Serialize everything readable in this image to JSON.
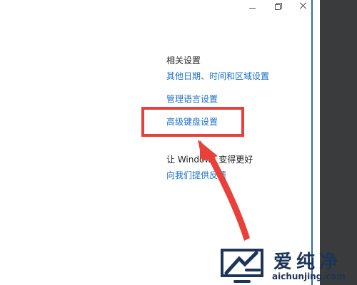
{
  "window_controls": {
    "minimize_icon": "minimize-icon",
    "restore_icon": "restore-icon",
    "close_icon": "close-icon"
  },
  "related_settings": {
    "title": "相关设置",
    "links": [
      "其他日期、时间和区域设置",
      "管理语言设置",
      "高级键盘设置"
    ]
  },
  "improve_windows": {
    "title": "让 Windows 变得更好",
    "feedback_link": "向我们提供反馈"
  },
  "annotation": {
    "highlight_color": "#e8413a"
  },
  "watermark": {
    "brand_cn": "爱纯净",
    "brand_url": "aichunjing.com",
    "logo_icon": "monitor-logo-icon",
    "brand_color": "#1d3557"
  },
  "colors": {
    "link": "#1a6fc9",
    "text": "#1f1f1f",
    "right_strip": "#3a3b3d",
    "window_border": "#2b6cb0"
  }
}
